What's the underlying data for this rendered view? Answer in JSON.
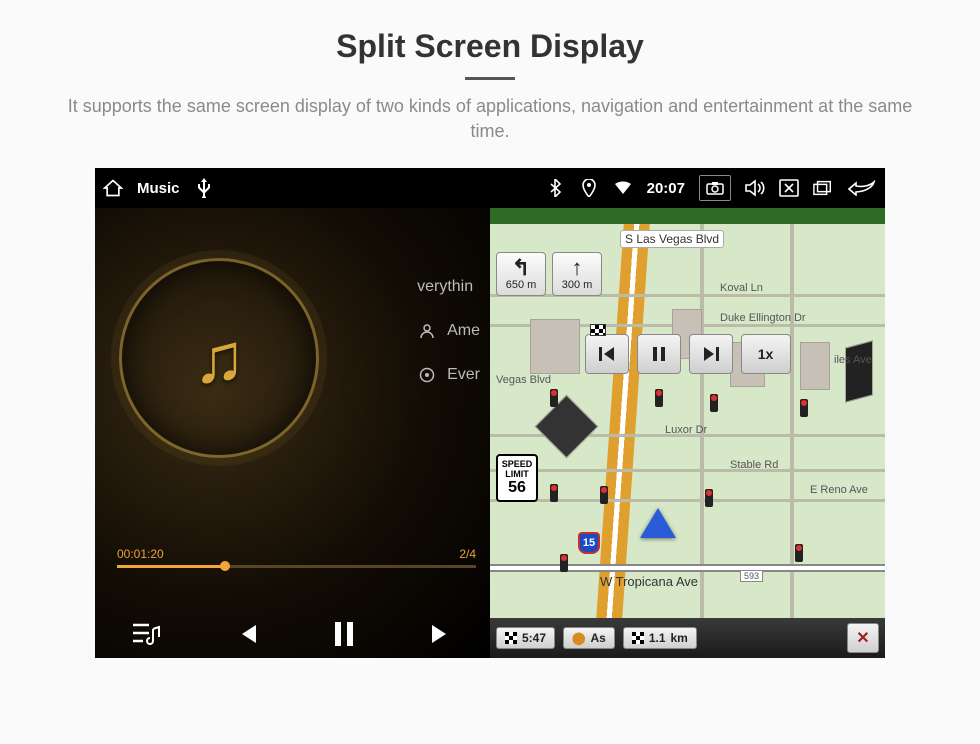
{
  "header": {
    "title": "Split Screen Display",
    "subtitle": "It supports the same screen display of two kinds of applications, navigation and entertainment at the same time."
  },
  "statusbar": {
    "app_label": "Music",
    "time": "20:07"
  },
  "music": {
    "tracks": {
      "t0": "verythin",
      "t1": "Ame",
      "t2": "Ever"
    },
    "elapsed": "00:01:20",
    "index": "2/4"
  },
  "nav": {
    "top_road": "S Las Vegas Blvd",
    "roads": {
      "koval": "Koval Ln",
      "duke": "Duke Ellington Dr",
      "vegas_blvd": "Vegas Blvd",
      "luxor": "Luxor Dr",
      "stable": "Stable Rd",
      "reno": "E Reno Ave",
      "tropicana": "W Tropicana Ave",
      "iles": "iles Ave"
    },
    "turn": {
      "primary_dist": "650",
      "primary_unit": "m",
      "secondary_dist": "300",
      "secondary_unit": "m"
    },
    "speed_limit_label": "SPEED\nLIMIT",
    "speed_limit": "56",
    "media_speed": "1x",
    "shield": "15",
    "trop_num": "593",
    "bottom": {
      "eta": "5:47",
      "dist1": "As",
      "dist2": "1.1",
      "dist2_unit": "km"
    }
  }
}
